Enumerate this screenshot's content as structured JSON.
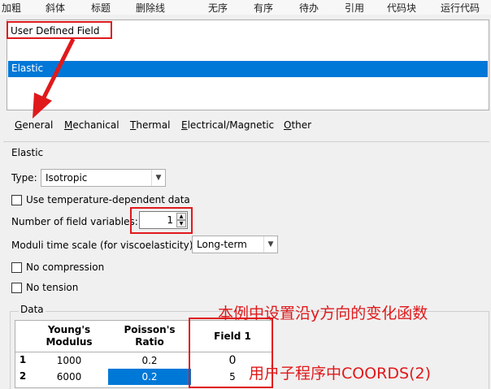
{
  "toolbar": {
    "items": [
      "加粗",
      "斜体",
      "标题",
      "删除线",
      "无序",
      "有序",
      "待办",
      "引用",
      "代码块",
      "运行代码"
    ]
  },
  "behaviors": {
    "header": "User Defined Field",
    "selected": "Elastic"
  },
  "menu": {
    "items": [
      {
        "first": "G",
        "rest": "eneral"
      },
      {
        "first": "M",
        "rest": "echanical"
      },
      {
        "first": "T",
        "rest": "hermal"
      },
      {
        "first": "E",
        "rest": "lectrical/Magnetic"
      },
      {
        "first": "O",
        "rest": "ther"
      }
    ]
  },
  "elastic": {
    "section_title": "Elastic",
    "type_label": "Type:",
    "type_value": "Isotropic",
    "temp_dependent_label": "Use temperature-dependent data",
    "field_vars_label": "Number of field variables:",
    "field_vars_value": "1",
    "moduli_label": "Moduli time scale (for viscoelasticity):",
    "moduli_value": "Long-term",
    "no_compression_label": "No compression",
    "no_tension_label": "No tension"
  },
  "data": {
    "group_label": "Data",
    "columns": [
      "Young's\nModulus",
      "Poisson's\nRatio",
      "Field 1"
    ],
    "rows": [
      {
        "index": "1",
        "cells": [
          "1000",
          "0.2",
          "0"
        ]
      },
      {
        "index": "2",
        "cells": [
          "6000",
          "0.2",
          "5"
        ]
      }
    ]
  },
  "annotations": {
    "note1": "本例中设置沿y方向的变化函数",
    "note2": "用户子程序中COORDS(2)"
  },
  "colors": {
    "selection": "#0078d7",
    "annotation_red": "#e0191b"
  }
}
